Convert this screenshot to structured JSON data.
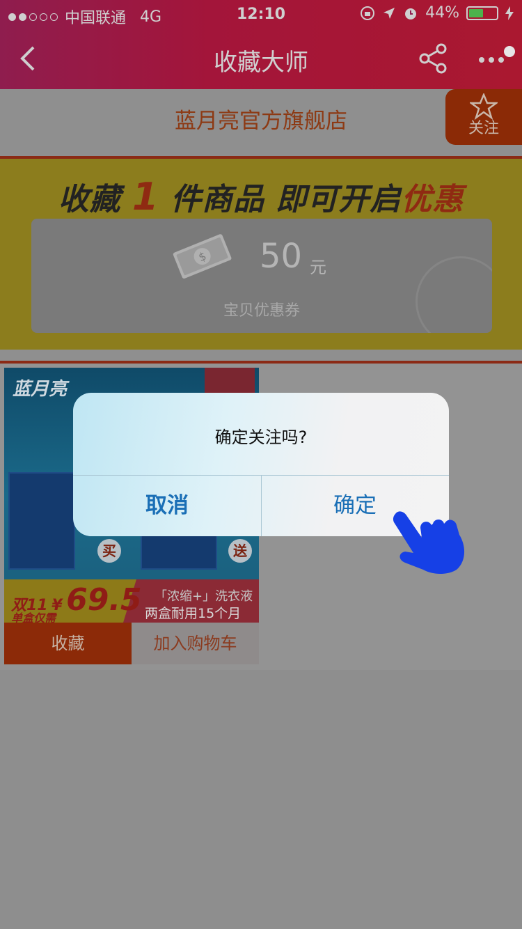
{
  "status_bar": {
    "carrier": "中国联通",
    "network": "4G",
    "time": "12:10",
    "battery": "44%",
    "signal_bars_filled": 2,
    "signal_bars_total": 5,
    "battery_level": 0.44
  },
  "nav": {
    "title": "收藏大师",
    "icons": [
      "back-icon",
      "share-icon",
      "more-icon"
    ]
  },
  "store": {
    "name": "蓝月亮官方旗舰店",
    "follow_label": "关注"
  },
  "banner": {
    "title_prefix": "收藏",
    "title_count": "1",
    "title_middle": "件商品 即可开启",
    "title_highlight": "优惠",
    "coupon_amount": "50",
    "coupon_unit": "元",
    "coupon_desc": "宝贝优惠券"
  },
  "product": {
    "brand": "蓝月亮",
    "badge_buy": "买",
    "badge_gift": "送",
    "promo_line1": "双11",
    "promo_currency": "¥",
    "promo_price": "69.5",
    "promo_line2": "单盒仅需",
    "strip_line1": "「浓缩+」洗衣液",
    "strip_line2": "两盒耐用15个月",
    "collect_label": "收藏",
    "cart_label": "加入购物车"
  },
  "dialog": {
    "message": "确定关注吗?",
    "cancel_label": "取消",
    "ok_label": "确定"
  },
  "colors": {
    "header_gradient": "#a3153a",
    "accent_orange": "#8c2a08",
    "dialog_button_text": "#1a6fb6",
    "hand_pointer": "#1640e6"
  }
}
